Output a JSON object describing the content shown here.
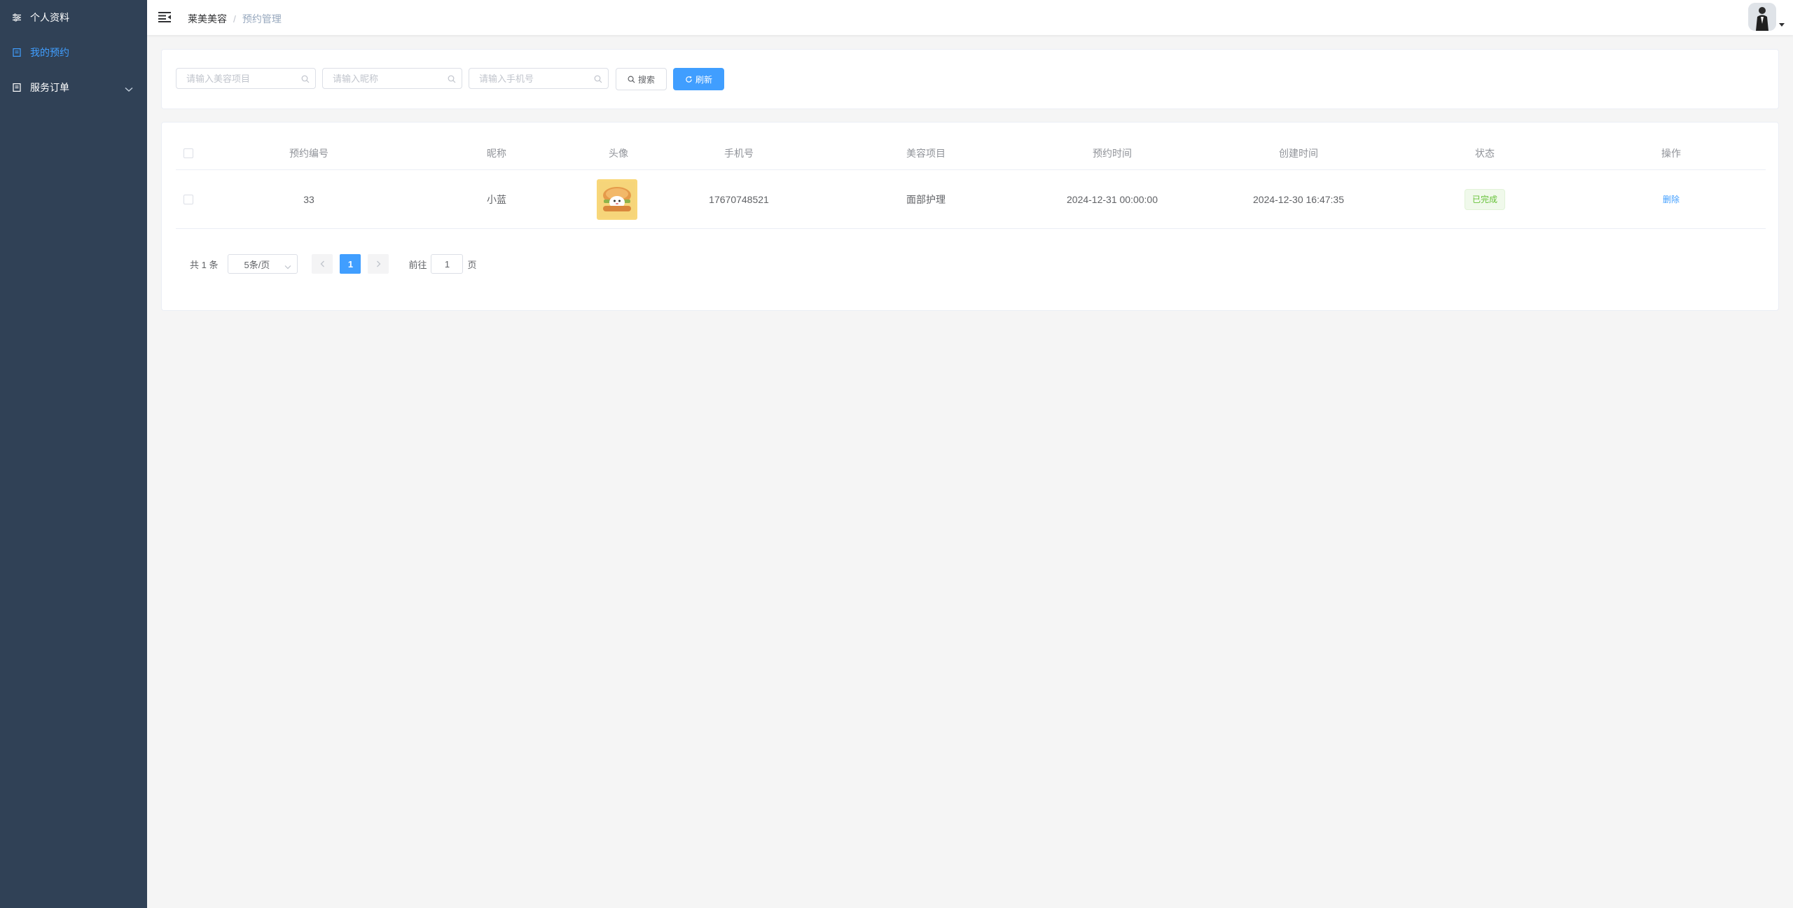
{
  "sidebar": {
    "items": [
      {
        "label": "个人资料",
        "icon": "sliders-icon"
      },
      {
        "label": "我的预约",
        "icon": "document-icon",
        "active": true
      },
      {
        "label": "服务订单",
        "icon": "document-icon",
        "has_children": true
      }
    ]
  },
  "header": {
    "breadcrumb": [
      "莱美美容",
      "预约管理"
    ],
    "separator": "/"
  },
  "search": {
    "project_placeholder": "请输入美容项目",
    "nickname_placeholder": "请输入昵称",
    "phone_placeholder": "请输入手机号",
    "search_label": "搜索",
    "refresh_label": "刷新"
  },
  "table": {
    "columns": [
      "预约编号",
      "昵称",
      "头像",
      "手机号",
      "美容项目",
      "预约时间",
      "创建时间",
      "状态",
      "操作"
    ],
    "rows": [
      {
        "id": "33",
        "nickname": "小蓝",
        "phone": "17670748521",
        "project": "面部护理",
        "appointment_time": "2024-12-31 00:00:00",
        "created_time": "2024-12-30 16:47:35",
        "status": "已完成",
        "action": "删除"
      }
    ]
  },
  "pagination": {
    "total": "共 1 条",
    "page_size": "5条/页",
    "current_page": "1",
    "goto_prefix": "前往",
    "goto_value": "1",
    "goto_suffix": "页"
  },
  "colors": {
    "sidebar_bg": "#304156",
    "accent": "#409eff",
    "success": "#67c23a"
  }
}
